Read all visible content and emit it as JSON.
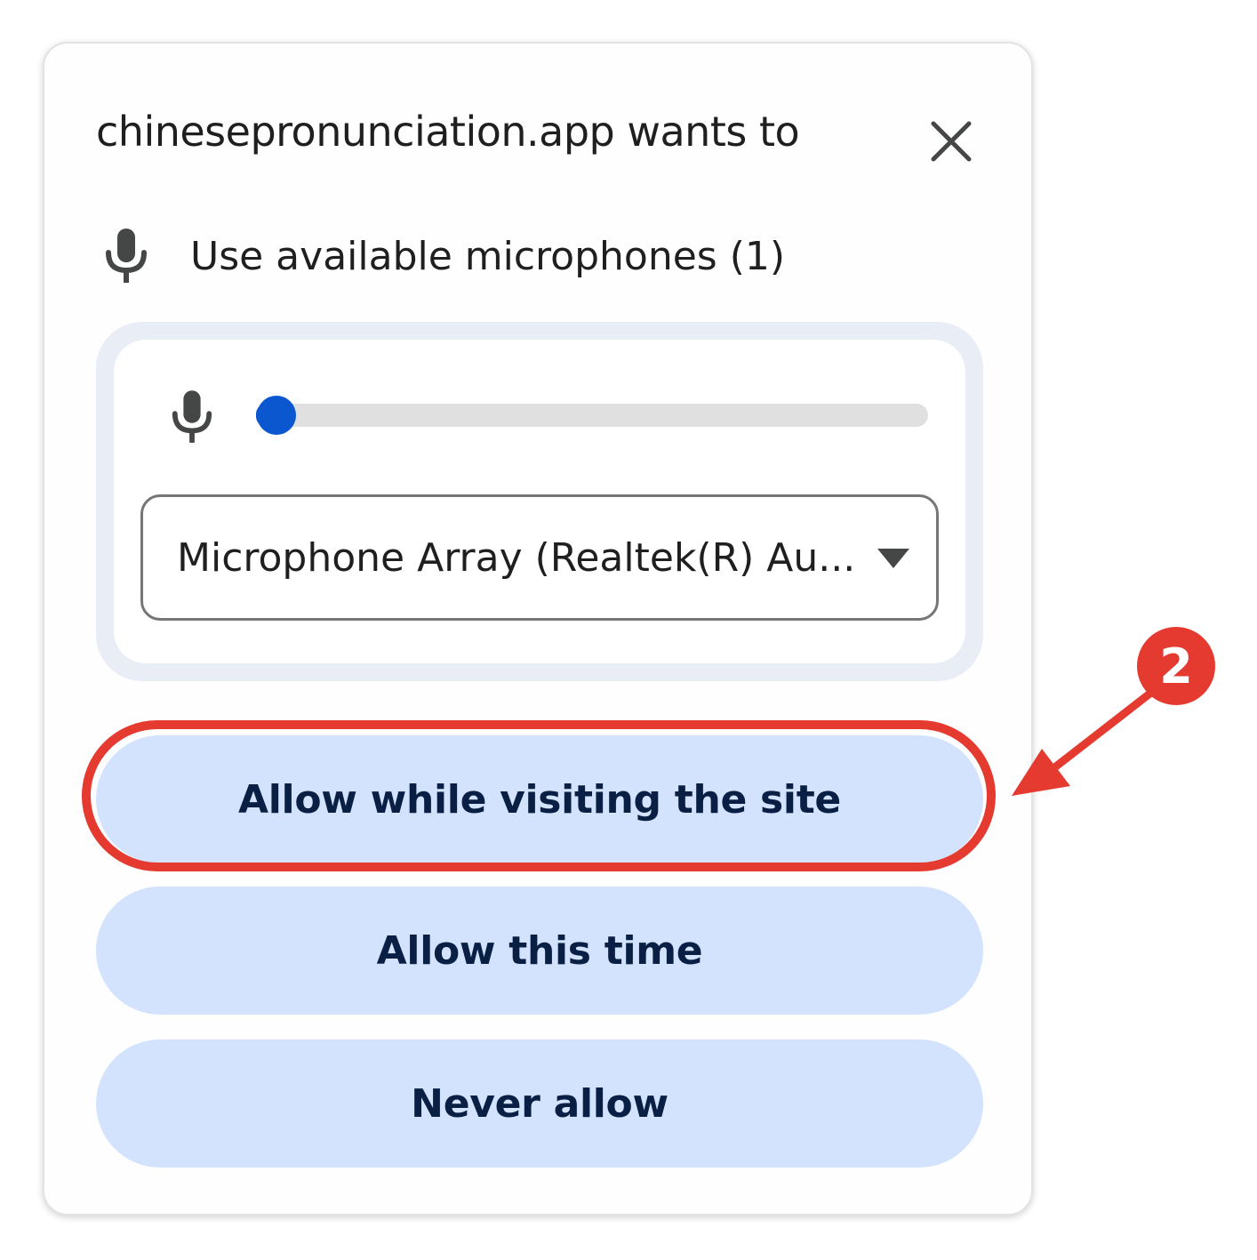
{
  "dialog": {
    "title": "chinesepronunciation.app wants to",
    "close_icon": "close-icon"
  },
  "permission": {
    "icon": "microphone-icon",
    "label": "Use available microphones (1)"
  },
  "device": {
    "level_icon": "microphone-icon",
    "input_level_fraction": 0.03,
    "selected_device": "Microphone Array (Realtek(R) Au...",
    "dropdown_icon": "caret-down-icon"
  },
  "buttons": {
    "allow_site": "Allow while visiting the site",
    "allow_once": "Allow this time",
    "never": "Never allow"
  },
  "annotation": {
    "step_number": "2",
    "color": "#e53a30"
  },
  "colors": {
    "accent": "#0b57d0",
    "button_bg": "#d3e3fd",
    "button_text": "#0a1f44"
  }
}
